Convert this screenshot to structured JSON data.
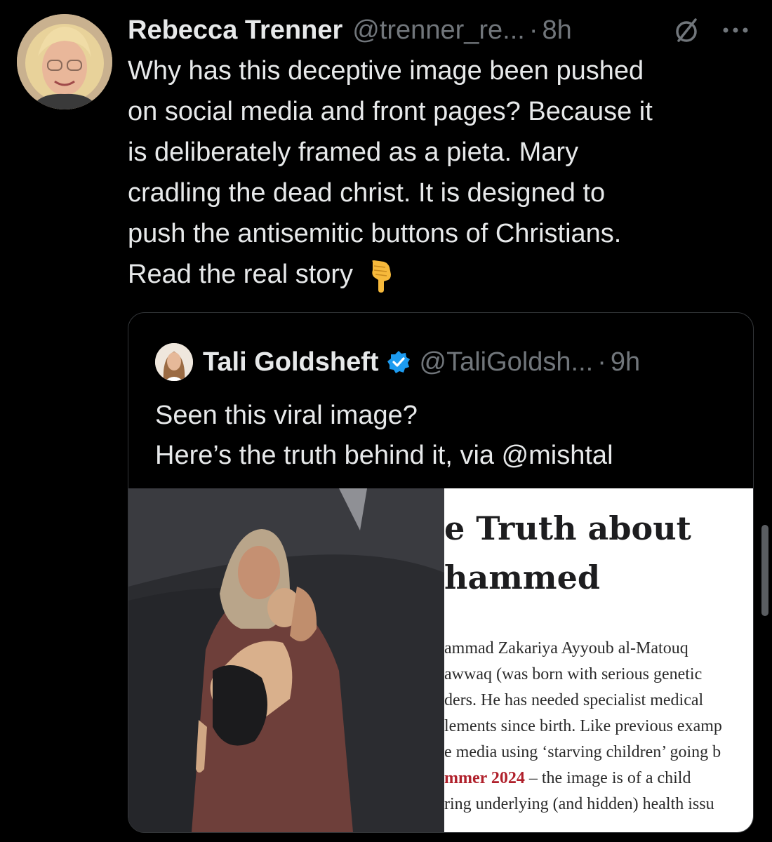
{
  "tweet": {
    "author_name": "Rebecca Trenner",
    "handle": "@trenner_re...",
    "separator": "·",
    "time": "8h",
    "text_lines": [
      "Why has this deceptive image been pushed",
      "on social media and front pages? Because it",
      "is deliberately framed as a pieta. Mary",
      "cradling the dead christ. It is designed to",
      "push the antisemitic buttons of Christians.",
      "Read the real story"
    ],
    "icons": [
      "avatar",
      "grok-icon",
      "more-icon",
      "pointing-down-emoji"
    ]
  },
  "quote": {
    "author_name": "Tali Goldsheft",
    "handle": "@TaliGoldsh...",
    "separator": "·",
    "time": "9h",
    "text_lines": [
      "Seen this viral image?",
      "Here’s the truth behind it, via @mishtal"
    ],
    "icons": [
      "avatar",
      "verified-badge-icon"
    ],
    "article": {
      "title_lines": [
        "e Truth about",
        "hammed"
      ],
      "body_lines": [
        "ammad Zakariya Ayyoub al-Matouq",
        "awwaq (was born with serious genetic",
        "ders. He has needed specialist medical",
        "lements since birth. Like previous examp",
        "e media using ‘starving children’ going b"
      ],
      "highlight": "mmer 2024",
      "highlight_rest": " – the image is of a child",
      "last_line": "ring underlying (and hidden) health issu"
    }
  },
  "colors": {
    "background": "#000000",
    "text": "#e7e9ea",
    "muted": "#71767b",
    "border": "#333639",
    "verified": "#1d9bf0",
    "article_highlight": "#b0202b"
  }
}
